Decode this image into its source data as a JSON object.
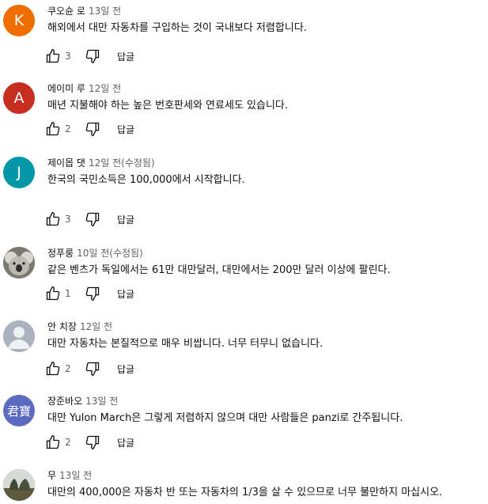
{
  "comments": [
    {
      "author": "쿠오슌 로",
      "time": "13일 전",
      "edited": "",
      "text": "해외에서 대만 자동차를 구입하는 것이 국내보다 저렴합니다.",
      "likes": "3",
      "reply_label": "답글",
      "avatar_letter": "K",
      "avatar_color": "#ef6c00"
    },
    {
      "author": "에이미 루",
      "time": "12일 전",
      "edited": "",
      "text": "매년 지불해야 하는 높은 번호판세와 연료세도 있습니다.",
      "likes": "2",
      "reply_label": "답글",
      "avatar_letter": "A",
      "avatar_color": "#c62f1f"
    },
    {
      "author": "제이몹 댓",
      "time": "12일 전",
      "edited": "(수정됨)",
      "text": "한국의 국민소득은 100,000에서 시작합니다.",
      "likes": "3",
      "reply_label": "답글",
      "avatar_letter": "J",
      "avatar_color": "#0097a7"
    },
    {
      "author": "정푸룽",
      "time": "10일 전",
      "edited": "(수정됨)",
      "text": "같은 벤츠가 독일에서는 61만 대만달러, 대만에서는 200만 달러 이상에 팔린다.",
      "likes": "1",
      "reply_label": "답글",
      "avatar_letter": "",
      "avatar_color": "#8a8a82"
    },
    {
      "author": "안 치장",
      "time": "12일 전",
      "edited": "",
      "text": "대만 자동차는 본질적으로 매우 비쌉니다. 너무 터무니 없습니다.",
      "likes": "2",
      "reply_label": "답글",
      "avatar_letter": "",
      "avatar_color": "#aab3bd"
    },
    {
      "author": "장준바오",
      "time": "13일 전",
      "edited": "",
      "text": "대만 Yulon March은 그렇게 저렴하지 않으며 대만 사람들은 panzi로 간주됩니다.",
      "likes": "2",
      "reply_label": "답글",
      "avatar_letter": "君寶",
      "avatar_color": "#5c6bc0"
    },
    {
      "author": "무",
      "time": "13일 전",
      "edited": "",
      "text": "대만의 400,000은 자동차 반 또는 자동차의 1/3을 살 수 있으므로 너무 불만하지 마십시오.",
      "likes": "",
      "reply_label": "",
      "avatar_letter": "",
      "avatar_color": "#6b6b55"
    }
  ],
  "icons": {
    "like": "thumb-up-icon",
    "dislike": "thumb-down-icon"
  }
}
